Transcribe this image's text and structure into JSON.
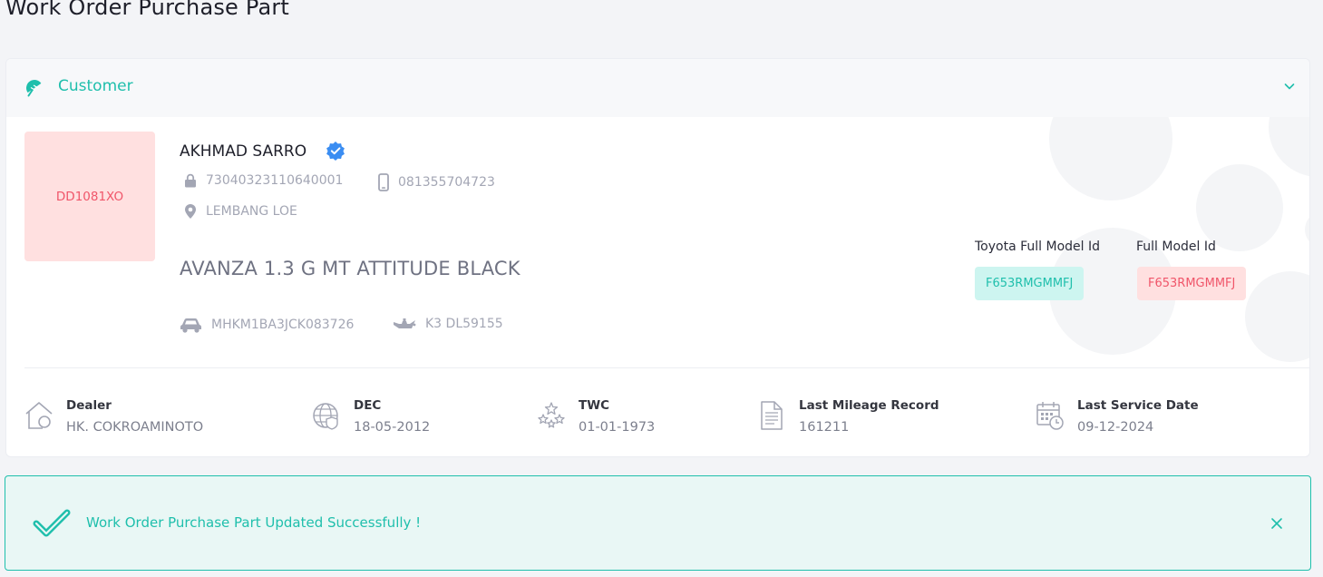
{
  "page": {
    "title": "Work Order Purchase Part"
  },
  "customer_panel": {
    "header_title": "Customer",
    "plate_number": "DD1081XO",
    "name": "AKHMAD SARRO",
    "id_number": "7304032311064000​1",
    "phone": "081355704723",
    "address": "LEMBANG LOE",
    "vehicle_model": "AVANZA 1.3 G MT ATTITUDE BLACK",
    "vin": "MHKM1BA3JCK083726",
    "engine_number": "K3 DL59155",
    "toyota_full_model_id_label": "Toyota Full Model Id",
    "toyota_full_model_id": "F653RMGMMFJ",
    "full_model_id_label": "Full Model Id",
    "full_model_id": "F653RMGMMFJ",
    "stats": [
      {
        "icon": "dealer-home-icon",
        "label": "Dealer",
        "value": "HK. COKROAMINOTO"
      },
      {
        "icon": "globe-shield-icon",
        "label": "DEC",
        "value": "18-05-2012"
      },
      {
        "icon": "stars-icon",
        "label": "TWC",
        "value": "01-01-1973"
      },
      {
        "icon": "document-icon",
        "label": "Last Mileage Record",
        "value": "161211"
      },
      {
        "icon": "calendar-clock-icon",
        "label": "Last Service Date",
        "value": "09-12-2024"
      }
    ]
  },
  "alert": {
    "message": "Work Order Purchase Part Updated Successfully !"
  },
  "colors": {
    "accent": "#1fbfac",
    "danger": "#f0566a",
    "danger_bg": "#ffe0e0",
    "accent_bg": "#cdf5f0",
    "verified": "#3a8df2"
  }
}
